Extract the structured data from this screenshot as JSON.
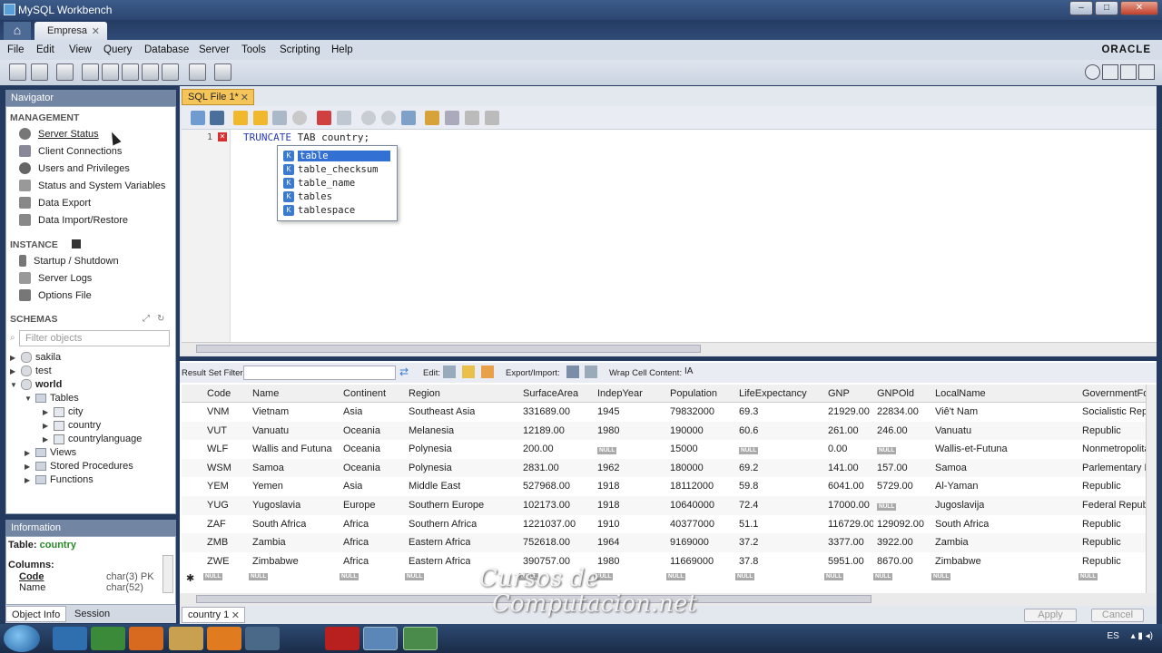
{
  "window": {
    "title": "MySQL Workbench",
    "connection_tab": "Empresa",
    "brand": "ORACLE"
  },
  "menu": [
    "File",
    "Edit",
    "View",
    "Query",
    "Database",
    "Server",
    "Tools",
    "Scripting",
    "Help"
  ],
  "navigator": {
    "title": "Navigator",
    "management_label": "MANAGEMENT",
    "management": [
      "Server Status",
      "Client Connections",
      "Users and Privileges",
      "Status and System Variables",
      "Data Export",
      "Data Import/Restore"
    ],
    "instance_label": "INSTANCE",
    "instance": [
      "Startup / Shutdown",
      "Server Logs",
      "Options File"
    ],
    "schemas_label": "SCHEMAS",
    "filter_placeholder": "Filter objects",
    "schemas": [
      "sakila",
      "test",
      "world"
    ],
    "world_children": {
      "tables_label": "Tables",
      "tables": [
        "city",
        "country",
        "countrylanguage"
      ],
      "views": "Views",
      "procedures": "Stored Procedures",
      "functions": "Functions"
    }
  },
  "information": {
    "title": "Information",
    "table_label": "Table:",
    "table_name": "country",
    "columns_label": "Columns:",
    "columns": [
      {
        "name": "Code",
        "type": "char(3) PK"
      },
      {
        "name": "Name",
        "type": "char(52)"
      }
    ],
    "tabs": [
      "Object Info",
      "Session"
    ]
  },
  "editor": {
    "tab": "SQL File 1*",
    "line_number": "1",
    "code_keyword": "TRUNCATE",
    "code_rest": " TAB country;",
    "autocomplete": [
      "table",
      "table_checksum",
      "table_name",
      "tables",
      "tablespace"
    ]
  },
  "result_toolbar": {
    "filter_label": "Result Set Filter:",
    "edit_label": "Edit:",
    "export_label": "Export/Import:",
    "wrap_label": "Wrap Cell Content:"
  },
  "grid": {
    "columns": [
      "Code",
      "Name",
      "Continent",
      "Region",
      "SurfaceArea",
      "IndepYear",
      "Population",
      "LifeExpectancy",
      "GNP",
      "GNPOld",
      "LocalName",
      "GovernmentFo"
    ],
    "rows": [
      [
        "VNM",
        "Vietnam",
        "Asia",
        "Southeast Asia",
        "331689.00",
        "1945",
        "79832000",
        "69.3",
        "21929.00",
        "22834.00",
        "Viê't Nam",
        "Socialistic Repu"
      ],
      [
        "VUT",
        "Vanuatu",
        "Oceania",
        "Melanesia",
        "12189.00",
        "1980",
        "190000",
        "60.6",
        "261.00",
        "246.00",
        "Vanuatu",
        "Republic"
      ],
      [
        "WLF",
        "Wallis and Futuna",
        "Oceania",
        "Polynesia",
        "200.00",
        "NULL",
        "15000",
        "NULL",
        "0.00",
        "NULL",
        "Wallis-et-Futuna",
        "Nonmetropolitan"
      ],
      [
        "WSM",
        "Samoa",
        "Oceania",
        "Polynesia",
        "2831.00",
        "1962",
        "180000",
        "69.2",
        "141.00",
        "157.00",
        "Samoa",
        "Parlementary M"
      ],
      [
        "YEM",
        "Yemen",
        "Asia",
        "Middle East",
        "527968.00",
        "1918",
        "18112000",
        "59.8",
        "6041.00",
        "5729.00",
        "Al-Yaman",
        "Republic"
      ],
      [
        "YUG",
        "Yugoslavia",
        "Europe",
        "Southern Europe",
        "102173.00",
        "1918",
        "10640000",
        "72.4",
        "17000.00",
        "NULL",
        "Jugoslavija",
        "Federal Republ"
      ],
      [
        "ZAF",
        "South Africa",
        "Africa",
        "Southern Africa",
        "1221037.00",
        "1910",
        "40377000",
        "51.1",
        "116729.00",
        "129092.00",
        "South Africa",
        "Republic"
      ],
      [
        "ZMB",
        "Zambia",
        "Africa",
        "Eastern Africa",
        "752618.00",
        "1964",
        "9169000",
        "37.2",
        "3377.00",
        "3922.00",
        "Zambia",
        "Republic"
      ],
      [
        "ZWE",
        "Zimbabwe",
        "Africa",
        "Eastern Africa",
        "390757.00",
        "1980",
        "11669000",
        "37.8",
        "5951.00",
        "8670.00",
        "Zimbabwe",
        "Republic"
      ]
    ]
  },
  "result_tab": "country 1",
  "buttons": {
    "apply": "Apply",
    "cancel": "Cancel"
  },
  "tray": {
    "lang": "ES"
  },
  "watermark": {
    "line1": "Cursos de",
    "line2": "Computacion.net"
  }
}
